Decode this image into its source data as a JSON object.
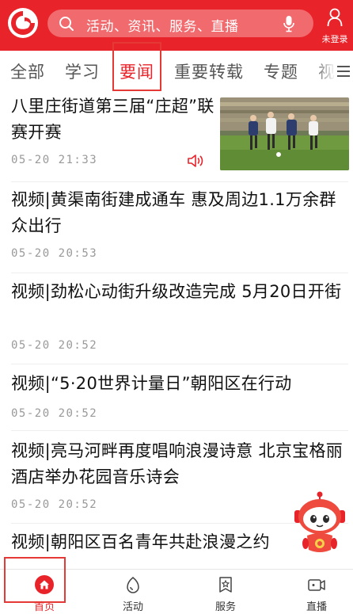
{
  "header": {
    "search_placeholder": "活动、资讯、服务、直播",
    "login_label": "未登录",
    "brand_color": "#e8232a"
  },
  "tabs": [
    {
      "label": "全部",
      "active": false
    },
    {
      "label": "学习",
      "active": false
    },
    {
      "label": "要闻",
      "active": true
    },
    {
      "label": "重要转载",
      "active": false
    },
    {
      "label": "专题",
      "active": false
    },
    {
      "label": "视",
      "active": false
    }
  ],
  "news": [
    {
      "title": "八里庄街道第三届“庄超”联赛开赛",
      "time": "05-20 21:33",
      "has_image": true,
      "has_audio": true
    },
    {
      "title": "视频|黄渠南街建成通车  惠及周边1.1万余群众出行",
      "time": "05-20 20:53"
    },
    {
      "title": "视频|劲松心动街升级改造完成  5月20日开街",
      "time": "05-20 20:52"
    },
    {
      "title": "视频|“5·20世界计量日”朝阳区在行动",
      "time": "05-20 20:52"
    },
    {
      "title": "视频|亮马河畔再度唱响浪漫诗意  北京宝格丽酒店举办花园音乐诗会",
      "time": "05-20 20:52"
    },
    {
      "title": "视频|朝阳区百名青年共赴浪漫之约",
      "time": ""
    }
  ],
  "bottom_nav": [
    {
      "label": "首页",
      "icon": "home-icon",
      "active": true
    },
    {
      "label": "活动",
      "icon": "activity-icon",
      "active": false
    },
    {
      "label": "服务",
      "icon": "service-icon",
      "active": false
    },
    {
      "label": "直播",
      "icon": "live-icon",
      "active": false
    }
  ]
}
